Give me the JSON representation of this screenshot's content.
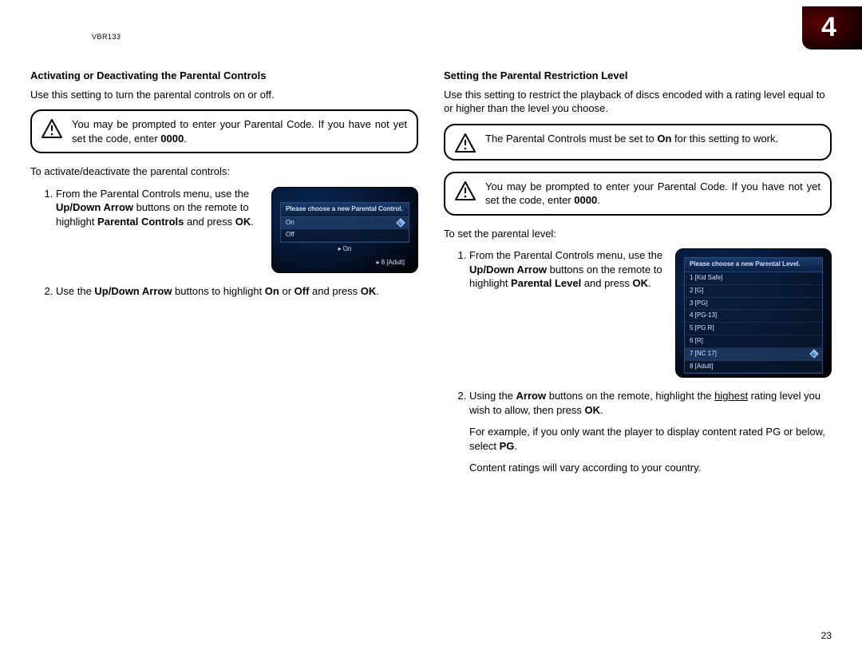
{
  "header": {
    "model": "VBR133",
    "chapter_number": "4"
  },
  "page_number": "23",
  "left": {
    "title": "Activating or Deactivating the Parental Controls",
    "intro": "Use this setting to turn the parental controls on or off.",
    "callout1_a": "You may be prompted to enter your Parental Code. If you have not yet set the code, enter ",
    "callout1_b": "0000",
    "callout1_c": ".",
    "lead": "To activate/deactivate the parental controls:",
    "s1_a": "From the Parental Controls menu, use the ",
    "s1_b": "Up/Down Arrow",
    "s1_c": " buttons on the remote to highlight ",
    "s1_d": "Parental Controls",
    "s1_e": " and press ",
    "s1_f": "OK",
    "s1_g": ".",
    "s2_a": "Use the ",
    "s2_b": "Up/Down Arrow",
    "s2_c": " buttons to highlight ",
    "s2_d": "On",
    "s2_e": " or ",
    "s2_f": "Off",
    "s2_g": " and press ",
    "s2_h": "OK",
    "s2_i": ".",
    "shot": {
      "title": "Please choose a new Parental Control.",
      "opt1": "On",
      "opt2": "Off",
      "sub_center": "On",
      "sub_right": "8 [Adult]"
    }
  },
  "right": {
    "title": "Setting the Parental Restriction Level",
    "intro": "Use this setting to restrict the playback of discs encoded with a rating level equal to or higher than the level you choose.",
    "callout1_a": "The Parental Controls must be set to ",
    "callout1_b": "On",
    "callout1_c": " for this setting to work.",
    "callout2_a": "You may be prompted to enter your Parental Code. If you have not yet set the code, enter ",
    "callout2_b": "0000",
    "callout2_c": ".",
    "lead": "To set the parental level:",
    "s1_a": "From the Parental Controls menu, use the ",
    "s1_b": "Up/Down Arrow",
    "s1_c": " buttons on the remote to highlight ",
    "s1_d": "Parental Level",
    "s1_e": " and press ",
    "s1_f": "OK",
    "s1_g": ".",
    "s2_a": "Using the ",
    "s2_b": "Arrow",
    "s2_c": " buttons on the remote, highlight the ",
    "s2_d": "highest",
    "s2_e": " rating level you wish to allow, then press ",
    "s2_f": "OK",
    "s2_g": ".",
    "s2_ex_a": "For example, if you only want the player to display content rated PG or below, select ",
    "s2_ex_b": "PG",
    "s2_ex_c": ".",
    "s2_note": "Content ratings will vary according to your country.",
    "shot": {
      "title": "Please choose a new Parental Level.",
      "l1": "1 [Kid Safe]",
      "l2": "2 [G]",
      "l3": "3 [PG]",
      "l4": "4 [PG-13]",
      "l5": "5 [PG R]",
      "l6": "6 [R]",
      "l7": "7 [NC 17]",
      "l8": "8 [Adult]"
    }
  }
}
